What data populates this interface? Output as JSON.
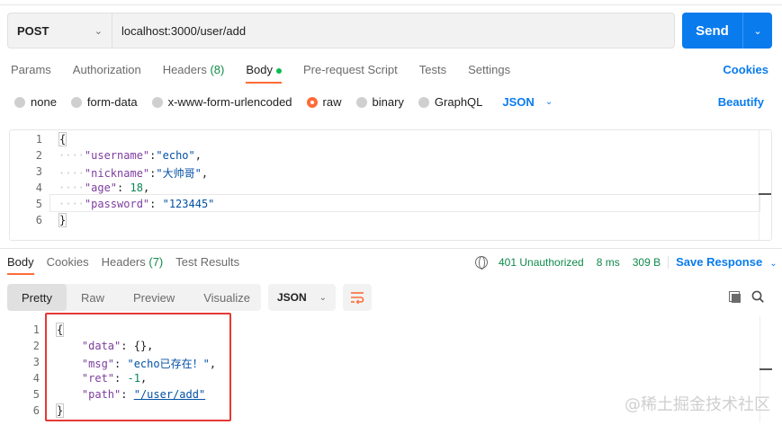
{
  "request": {
    "method": "POST",
    "url": "localhost:3000/user/add",
    "send_label": "Send"
  },
  "request_tabs": [
    {
      "label": "Params"
    },
    {
      "label": "Authorization"
    },
    {
      "label": "Headers",
      "count": "(8)"
    },
    {
      "label": "Body"
    },
    {
      "label": "Pre-request Script"
    },
    {
      "label": "Tests"
    },
    {
      "label": "Settings"
    }
  ],
  "cookies_label": "Cookies",
  "body_types": [
    "none",
    "form-data",
    "x-www-form-urlencoded",
    "raw",
    "binary",
    "GraphQL"
  ],
  "body_format": "JSON",
  "beautify_label": "Beautify",
  "request_body": {
    "line_numbers": [
      "1",
      "2",
      "3",
      "4",
      "5",
      "6"
    ],
    "open": "{",
    "close": "}",
    "fields": [
      {
        "key": "\"username\"",
        "sep": ":",
        "value": "\"echo\"",
        "comma": ","
      },
      {
        "key": "\"nickname\"",
        "sep": ":",
        "value": "\"大帅哥\"",
        "comma": ","
      },
      {
        "key": "\"age\"",
        "sep": ": ",
        "value": "18",
        "comma": ","
      },
      {
        "key": "\"password\"",
        "sep": ": ",
        "value": "\"123445\"",
        "comma": ""
      }
    ]
  },
  "response_tabs": [
    {
      "label": "Body"
    },
    {
      "label": "Cookies"
    },
    {
      "label": "Headers",
      "count": "(7)"
    },
    {
      "label": "Test Results"
    }
  ],
  "response_meta": {
    "status": "401 Unauthorized",
    "time": "8 ms",
    "size": "309 B",
    "save_label": "Save Response"
  },
  "view_modes": [
    "Pretty",
    "Raw",
    "Preview",
    "Visualize"
  ],
  "response_format": "JSON",
  "response_body": {
    "line_numbers": [
      "1",
      "2",
      "3",
      "4",
      "5",
      "6"
    ],
    "open": "{",
    "close": "}",
    "fields": [
      {
        "key": "\"data\"",
        "value": "{}",
        "comma": ","
      },
      {
        "key": "\"msg\"",
        "value": "\"echo已存在！\"",
        "comma": ","
      },
      {
        "key": "\"ret\"",
        "value": "-1",
        "comma": ","
      },
      {
        "key": "\"path\"",
        "value": "\"/user/add\"",
        "comma": ""
      }
    ]
  },
  "watermark": "@稀土掘金技术社区",
  "colors": {
    "accent": "#ff6c37",
    "primary": "#097bed",
    "status": "#0f8a4a",
    "highlight": "#e53935"
  }
}
